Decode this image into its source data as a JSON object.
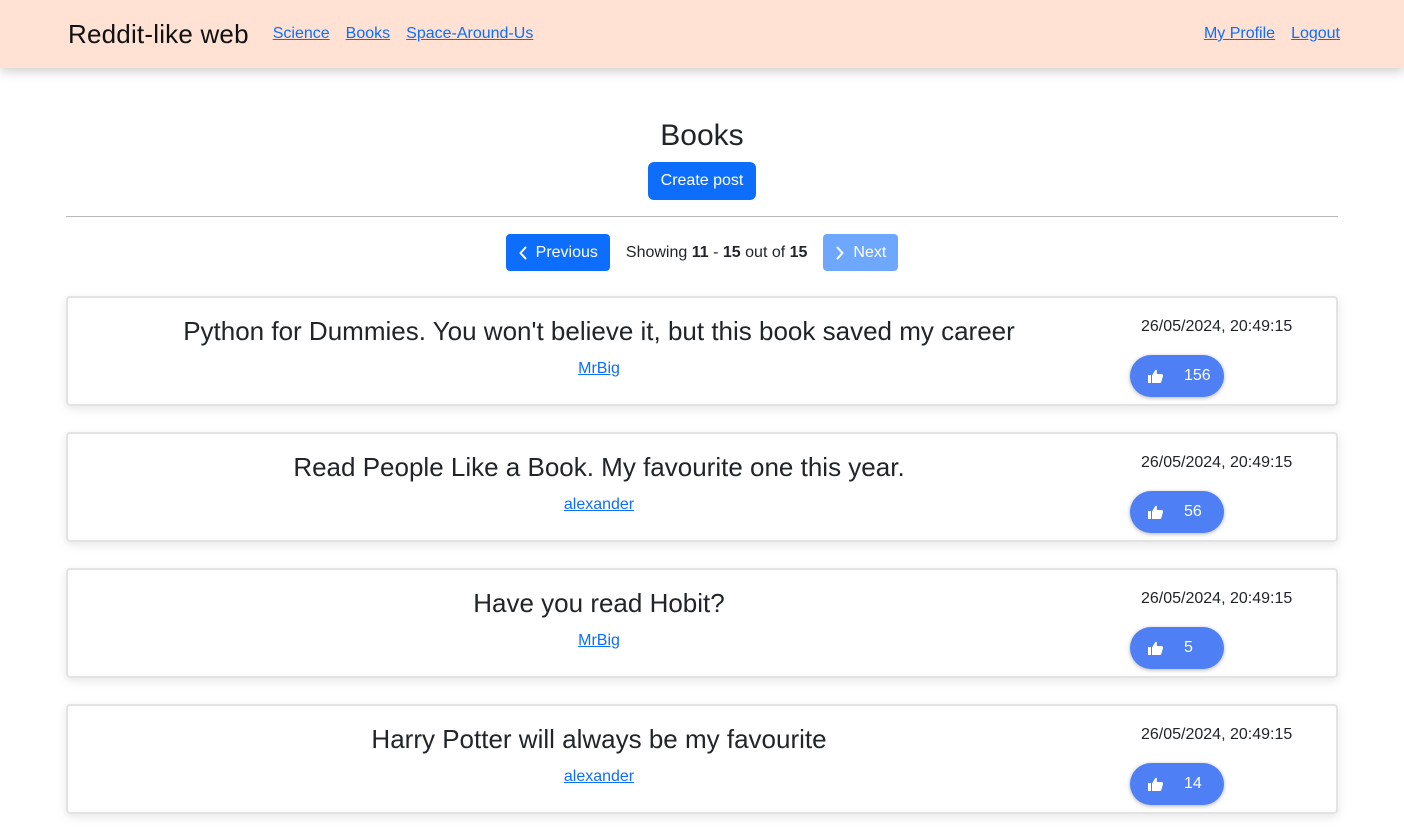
{
  "nav": {
    "brand": "Reddit-like web",
    "links": [
      "Science",
      "Books",
      "Space-Around-Us"
    ],
    "profile": "My Profile",
    "logout": "Logout"
  },
  "page": {
    "title": "Books",
    "create_label": "Create post"
  },
  "pager": {
    "prev_label": "Previous",
    "next_label": "Next",
    "showing_prefix": "Showing",
    "from": "11",
    "dash": "-",
    "to": "15",
    "out_of": "out of",
    "total": "15"
  },
  "posts": [
    {
      "title": "Python for Dummies. You won't believe it, but this book saved my career",
      "author": "MrBig",
      "date": "26/05/2024, 20:49:15",
      "likes": "156"
    },
    {
      "title": "Read People Like a Book. My favourite one this year.",
      "author": "alexander",
      "date": "26/05/2024, 20:49:15",
      "likes": "56"
    },
    {
      "title": "Have you read Hobit?",
      "author": "MrBig",
      "date": "26/05/2024, 20:49:15",
      "likes": "5"
    },
    {
      "title": "Harry Potter will always be my favourite",
      "author": "alexander",
      "date": "26/05/2024, 20:49:15",
      "likes": "14"
    }
  ],
  "icons": {
    "prev": "chevron-left-icon",
    "next": "chevron-right-icon",
    "like": "thumbs-up-icon"
  },
  "colors": {
    "navbar_bg": "#ffe2d3",
    "primary": "#0d6efd",
    "next_disabled": "#6ea8fe",
    "like_button": "#4e7ff5"
  }
}
